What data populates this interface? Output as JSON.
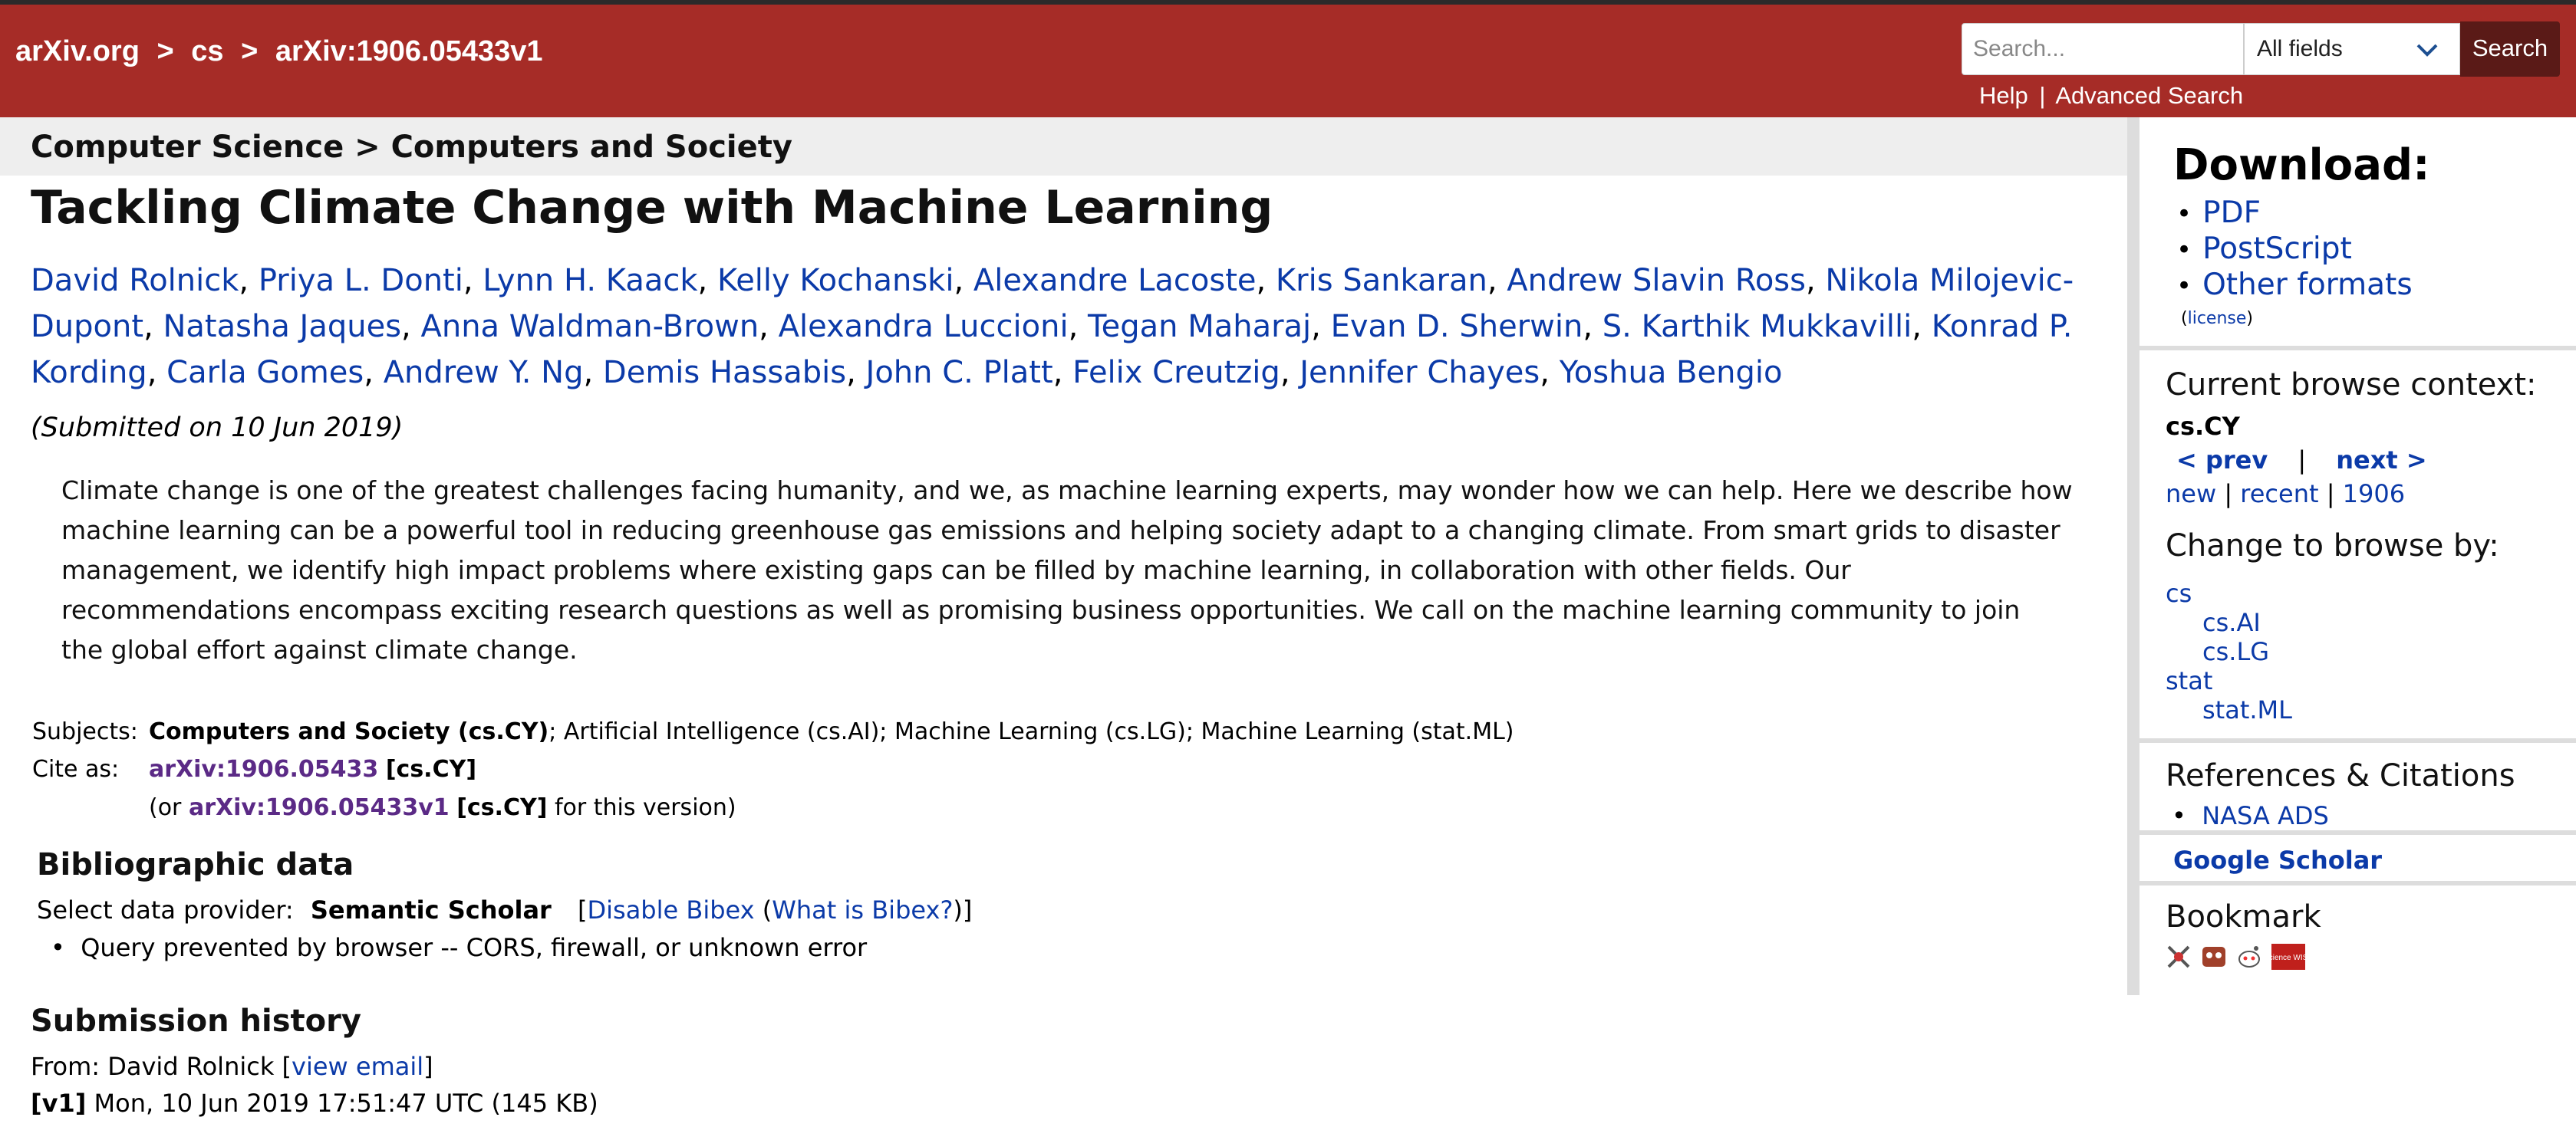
{
  "header": {
    "crumb_site": "arXiv.org",
    "crumb_sep": ">",
    "crumb_cat": "cs",
    "crumb_id": "arXiv:1906.05433v1",
    "search_placeholder": "Search...",
    "field_select": "All fields",
    "search_button": "Search",
    "help": "Help",
    "divider": "|",
    "advanced": "Advanced Search"
  },
  "subheader": {
    "text": "Computer Science > Computers and Society"
  },
  "paper": {
    "title": "Tackling Climate Change with Machine Learning",
    "authors": [
      "David Rolnick",
      "Priya L. Donti",
      "Lynn H. Kaack",
      "Kelly Kochanski",
      "Alexandre Lacoste",
      "Kris Sankaran",
      "Andrew Slavin Ross",
      "Nikola Milojevic-",
      "Dupont",
      "Natasha Jaques",
      "Anna Waldman-Brown",
      "Alexandra Luccioni",
      "Tegan Maharaj",
      "Evan D. Sherwin",
      "S. Karthik Mukkavilli",
      "Konrad P.",
      "Kording",
      "Carla Gomes",
      "Andrew Y. Ng",
      "Demis Hassabis",
      "John C. Platt",
      "Felix Creutzig",
      "Jennifer Chayes",
      "Yoshua Bengio"
    ],
    "submitted": "(Submitted on 10 Jun 2019)",
    "abstract_lines": [
      "Climate change is one of the greatest challenges facing humanity, and we, as machine learning experts, may wonder how we can help. Here we describe how",
      "machine learning can be a powerful tool in reducing greenhouse gas emissions and helping society adapt to a changing climate. From smart grids to disaster",
      "management, we identify high impact problems where existing gaps can be filled by machine learning, in collaboration with other fields. Our",
      "recommendations encompass exciting research questions as well as promising business opportunities. We call on the machine learning community to join",
      "the global effort against climate change."
    ]
  },
  "meta": {
    "subjects_label": "Subjects:",
    "subjects_primary": "Computers and Society (cs.CY)",
    "subjects_rest": "; Artificial Intelligence (cs.AI); Machine Learning (cs.LG); Machine Learning (stat.ML)",
    "cite_label": "Cite as:",
    "cite_id": "arXiv:1906.05433",
    "cite_cat": "[cs.CY]",
    "or_prefix": "(or",
    "or_id": "arXiv:1906.05433v1",
    "or_cat": "[cs.CY]",
    "or_suffix": "for this version)"
  },
  "bibliographic": {
    "heading": "Bibliographic data",
    "select_label": "Select data provider:",
    "provider": "Semantic Scholar",
    "disable_open": "[",
    "disable": "Disable Bibex",
    "what_open": "(",
    "what": "What is Bibex?",
    "what_close": ")]",
    "error": "Query prevented by browser -- CORS, firewall, or unknown error"
  },
  "history": {
    "heading": "Submission history",
    "from_prefix": "From: David Rolnick [",
    "view_email": "view email",
    "from_suffix": "]",
    "v1_label": "[v1]",
    "v1_text": "Mon, 10 Jun 2019 17:51:47 UTC (145 KB)"
  },
  "sidebar": {
    "download_title": "Download:",
    "pdf": "PDF",
    "postscript": "PostScript",
    "other": "Other formats",
    "license_open": "(",
    "license": "license",
    "license_close": ")",
    "context_title": "Current browse context:",
    "context_value": "cs.CY",
    "prev": "< prev",
    "pipe": "|",
    "next": "next >",
    "new": "new",
    "recent": "recent",
    "year": "1906",
    "change_title": "Change to browse by:",
    "cs": "cs",
    "cs_ai": "cs.AI",
    "cs_lg": "cs.LG",
    "stat": "stat",
    "stat_ml": "stat.ML",
    "refs_title": "References & Citations",
    "nasa": "NASA ADS",
    "google": "Google Scholar",
    "bookmark_title": "Bookmark",
    "sciencewise_label": "Science WISE"
  },
  "colors": {
    "header_bg": "#a62c27",
    "link": "#0b3aa8",
    "search_button": "#5a1a17"
  }
}
